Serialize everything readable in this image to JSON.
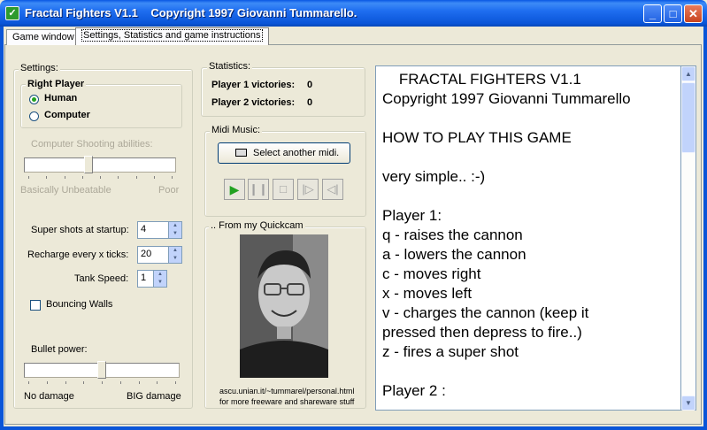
{
  "window": {
    "title": "Fractal Fighters V1.1    Copyright 1997 Giovanni Tummarello.",
    "icon_letter": "✓",
    "minimize": "_",
    "maximize": "□",
    "close": "✕"
  },
  "tabs": [
    "Game window",
    "Settings, Statistics and game instructions"
  ],
  "settings": {
    "label": "Settings:",
    "right_player": {
      "label": "Right Player",
      "options": [
        "Human",
        "Computer"
      ],
      "selected": "Human"
    },
    "computer_shooting": {
      "label": "Computer Shooting abilities:",
      "min_label": "Basically Unbeatable",
      "max_label": "Poor",
      "level": 0.42
    },
    "super_shots": {
      "label": "Super shots at startup:",
      "value": "4"
    },
    "recharge": {
      "label": "Recharge every x ticks:",
      "value": "20"
    },
    "tank_speed": {
      "label": "Tank Speed:",
      "value": "1"
    },
    "bouncing_walls": {
      "label": "Bouncing Walls",
      "checked": false
    },
    "bullet_power": {
      "label": "Bullet power:",
      "min_label": "No damage",
      "max_label": "BIG damage",
      "level": 0.5
    }
  },
  "statistics": {
    "label": "Statistics:",
    "player1_label": "Player 1 victories:",
    "player1_value": "0",
    "player2_label": "Player 2 victories:",
    "player2_value": "0"
  },
  "midi": {
    "label": "Midi Music:",
    "select_button": "Select another midi.",
    "controls": [
      "play",
      "pause",
      "stop",
      "previous",
      "next"
    ]
  },
  "quickcam": {
    "label": ".. From my Quickcam",
    "caption_line1": "ascu.unian.it/~tummarel/personal.html",
    "caption_line2": "for more freeware and shareware stuff"
  },
  "instructions": {
    "lines": [
      "    FRACTAL FIGHTERS V1.1",
      "Copyright 1997 Giovanni Tummarello",
      "",
      "HOW TO PLAY THIS GAME",
      "",
      "very simple.. :-)",
      "",
      "Player 1:",
      "q - raises the cannon",
      "a - lowers the cannon",
      "c - moves right",
      "x - moves left",
      "v - charges the cannon (keep it",
      "pressed then depress to fire..)",
      "z - fires a super shot",
      "",
      "Player 2 :"
    ]
  },
  "colors": {
    "titlebar": "#0a55d8",
    "play_green": "#21a121",
    "background": "#ece9d8"
  }
}
